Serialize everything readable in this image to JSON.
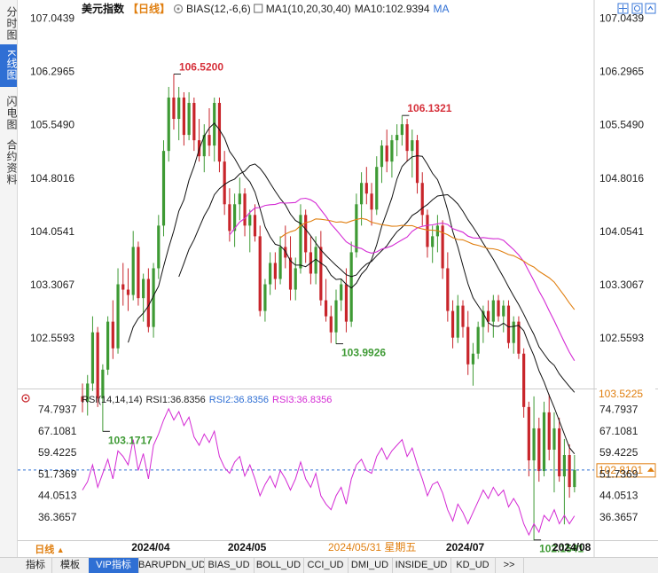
{
  "sidebar": {
    "tabs": [
      {
        "label": "分时图",
        "active": false
      },
      {
        "label": "K线图",
        "active": true
      },
      {
        "label": "闪电图",
        "active": false
      },
      {
        "label": "合约资料",
        "active": false
      }
    ]
  },
  "header": {
    "title": "美元指数",
    "period": "【日线】",
    "indicator": "BIAS(12,-6,6)",
    "ma_params": "MA1(10,20,30,40)",
    "ma10_value": "MA10:102.9394",
    "ma_tag": "MA"
  },
  "right_icons": {
    "analysis": "分析",
    "settings": "设置",
    "collapse": "收起"
  },
  "rsi_header": {
    "label": "RSI(14,14,14)",
    "rsi1": "RSI1:36.8356",
    "rsi2": "RSI2:36.8356",
    "rsi3": "RSI3:36.8356"
  },
  "bottom_bar": {
    "period_button": "日线",
    "tabs": [
      "指标",
      "模板",
      "VIP指标",
      "BARUPDN_UD",
      "BIAS_UD",
      "BOLL_UD",
      "CCI_UD",
      "DMI_UD",
      "INSIDE_UD",
      "KD_UD",
      ">>"
    ]
  },
  "colors": {
    "up": "#3e9a34",
    "down": "#c8252b",
    "ma10": "#111111",
    "ma20": "#111111",
    "ma30": "#d42ad4",
    "ma40": "#e07f10",
    "rsi": "#d42ad4",
    "current_price": "#2f6fd4",
    "date_highlight": "#e07f10"
  },
  "chart_data": [
    {
      "type": "candlestick",
      "title": "美元指数",
      "yticks": [
        "107.0439",
        "106.2965",
        "105.5490",
        "104.8016",
        "104.0541",
        "103.3067",
        "102.5593"
      ],
      "ylim": [
        102.2,
        107.04
      ],
      "xticks": [
        {
          "label": "2024/04",
          "index": 10
        },
        {
          "label": "2024/05",
          "index": 29
        },
        {
          "label": "2024/07",
          "index": 72
        },
        {
          "label": "2024/08",
          "index": 93
        }
      ],
      "crosshair_date": "2024/05/31 星期五",
      "current_price": "102.8101",
      "last_marker": "103.5225",
      "annotations": [
        {
          "label": "106.5200",
          "index": 18,
          "value": 106.52,
          "kind": "high"
        },
        {
          "label": "106.1321",
          "index": 63,
          "value": 106.1321,
          "kind": "high"
        },
        {
          "label": "103.9926",
          "index": 50,
          "value": 103.9926,
          "kind": "low"
        },
        {
          "label": "103.1717",
          "index": 4,
          "value": 103.1717,
          "kind": "low"
        },
        {
          "label": "102.1541",
          "index": 89,
          "value": 102.1541,
          "kind": "low"
        }
      ],
      "candles": [
        [
          103.5,
          103.62,
          103.35,
          103.45
        ],
        [
          103.45,
          103.7,
          103.32,
          103.62
        ],
        [
          103.62,
          104.25,
          103.55,
          104.1
        ],
        [
          104.1,
          104.15,
          103.4,
          103.48
        ],
        [
          103.48,
          103.8,
          103.17,
          103.75
        ],
        [
          103.75,
          104.25,
          103.7,
          104.2
        ],
        [
          104.2,
          104.4,
          103.85,
          103.95
        ],
        [
          103.95,
          104.7,
          103.9,
          104.55
        ],
        [
          104.55,
          104.75,
          104.35,
          104.5
        ],
        [
          104.5,
          104.7,
          104.3,
          104.45
        ],
        [
          104.45,
          105.05,
          104.4,
          104.9
        ],
        [
          104.9,
          104.95,
          104.35,
          104.42
        ],
        [
          104.42,
          104.65,
          104.2,
          104.6
        ],
        [
          104.6,
          104.7,
          104.1,
          104.15
        ],
        [
          104.15,
          104.75,
          104.05,
          104.7
        ],
        [
          104.7,
          105.2,
          104.6,
          105.1
        ],
        [
          105.1,
          105.9,
          105.0,
          105.8
        ],
        [
          105.8,
          106.4,
          105.7,
          106.3
        ],
        [
          106.3,
          106.52,
          106.0,
          106.1
        ],
        [
          106.1,
          106.4,
          105.9,
          106.3
        ],
        [
          106.3,
          106.35,
          105.85,
          105.95
        ],
        [
          105.95,
          106.35,
          105.9,
          106.25
        ],
        [
          106.25,
          106.3,
          105.8,
          105.9
        ],
        [
          105.9,
          106.1,
          105.7,
          105.75
        ],
        [
          105.75,
          106.05,
          105.6,
          105.95
        ],
        [
          105.95,
          106.2,
          105.75,
          105.85
        ],
        [
          105.85,
          106.3,
          105.7,
          106.25
        ],
        [
          106.25,
          106.3,
          105.6,
          105.7
        ],
        [
          105.7,
          105.8,
          105.2,
          105.3
        ],
        [
          105.3,
          105.45,
          104.95,
          105.05
        ],
        [
          105.05,
          105.4,
          104.9,
          105.3
        ],
        [
          105.3,
          105.55,
          105.15,
          105.4
        ],
        [
          105.4,
          105.45,
          105.0,
          105.1
        ],
        [
          105.1,
          105.25,
          104.85,
          105.2
        ],
        [
          105.2,
          105.3,
          104.95,
          105.0
        ],
        [
          105.0,
          105.1,
          104.25,
          104.3
        ],
        [
          104.3,
          104.6,
          104.2,
          104.55
        ],
        [
          104.55,
          104.85,
          104.45,
          104.75
        ],
        [
          104.75,
          104.85,
          104.5,
          104.6
        ],
        [
          104.6,
          105.0,
          104.55,
          104.9
        ],
        [
          104.9,
          105.1,
          104.7,
          104.8
        ],
        [
          104.8,
          105.0,
          104.4,
          104.5
        ],
        [
          104.5,
          104.8,
          104.4,
          104.7
        ],
        [
          104.7,
          105.3,
          104.65,
          105.2
        ],
        [
          105.2,
          105.25,
          104.75,
          104.85
        ],
        [
          104.85,
          105.0,
          104.55,
          104.65
        ],
        [
          104.65,
          105.0,
          104.55,
          104.9
        ],
        [
          104.9,
          105.05,
          104.35,
          104.4
        ],
        [
          104.4,
          104.6,
          104.2,
          104.25
        ],
        [
          104.25,
          104.35,
          104.0,
          104.1
        ],
        [
          104.1,
          104.5,
          103.99,
          104.4
        ],
        [
          104.4,
          104.6,
          104.3,
          104.55
        ],
        [
          104.55,
          104.7,
          104.1,
          104.2
        ],
        [
          104.2,
          104.95,
          104.15,
          104.85
        ],
        [
          104.85,
          105.4,
          104.8,
          105.3
        ],
        [
          105.3,
          105.6,
          105.1,
          105.5
        ],
        [
          105.5,
          105.65,
          105.3,
          105.4
        ],
        [
          105.4,
          105.5,
          105.1,
          105.25
        ],
        [
          105.25,
          105.75,
          105.2,
          105.65
        ],
        [
          105.65,
          105.9,
          105.5,
          105.85
        ],
        [
          105.85,
          106.0,
          105.6,
          105.7
        ],
        [
          105.7,
          105.95,
          105.55,
          105.9
        ],
        [
          105.9,
          106.05,
          105.75,
          105.95
        ],
        [
          105.95,
          106.13,
          105.85,
          106.05
        ],
        [
          106.05,
          106.1,
          105.7,
          105.8
        ],
        [
          105.8,
          106.0,
          105.55,
          105.9
        ],
        [
          105.9,
          105.95,
          105.4,
          105.5
        ],
        [
          105.5,
          105.6,
          105.1,
          105.2
        ],
        [
          105.2,
          105.25,
          104.8,
          104.9
        ],
        [
          104.9,
          105.1,
          104.75,
          105.0
        ],
        [
          105.0,
          105.2,
          104.85,
          105.1
        ],
        [
          105.1,
          105.15,
          104.6,
          104.7
        ],
        [
          104.7,
          104.85,
          104.2,
          104.3
        ],
        [
          104.3,
          104.4,
          103.95,
          104.05
        ],
        [
          104.05,
          104.45,
          104.0,
          104.35
        ],
        [
          104.35,
          104.4,
          104.05,
          104.15
        ],
        [
          104.15,
          104.3,
          103.7,
          103.8
        ],
        [
          103.8,
          104.0,
          103.6,
          103.9
        ],
        [
          103.9,
          104.2,
          103.85,
          104.15
        ],
        [
          104.15,
          104.35,
          104.0,
          104.3
        ],
        [
          104.3,
          104.4,
          104.1,
          104.2
        ],
        [
          104.2,
          104.45,
          104.05,
          104.4
        ],
        [
          104.4,
          104.45,
          104.2,
          104.25
        ],
        [
          104.25,
          104.4,
          104.1,
          104.35
        ],
        [
          104.35,
          104.4,
          103.95,
          104.0
        ],
        [
          104.0,
          104.25,
          103.9,
          104.2
        ],
        [
          104.2,
          104.25,
          103.85,
          103.9
        ],
        [
          103.9,
          103.95,
          103.3,
          103.4
        ],
        [
          103.4,
          103.45,
          102.75,
          102.9
        ],
        [
          102.9,
          103.5,
          102.15,
          103.2
        ],
        [
          103.2,
          103.3,
          102.7,
          102.8
        ],
        [
          102.8,
          103.45,
          102.75,
          103.35
        ],
        [
          103.35,
          103.52,
          102.9,
          103.0
        ],
        [
          103.0,
          103.35,
          102.6,
          103.2
        ],
        [
          103.2,
          103.3,
          102.7,
          102.75
        ],
        [
          102.75,
          103.1,
          102.3,
          102.95
        ],
        [
          102.95,
          103.05,
          102.55,
          102.65
        ],
        [
          102.65,
          102.95,
          102.6,
          102.81
        ]
      ]
    },
    {
      "type": "line",
      "title": "RSI(14,14,14)",
      "yticks": [
        "74.7937",
        "67.1081",
        "59.4225",
        "51.7369",
        "44.0513",
        "36.3657"
      ],
      "ylim": [
        32.0,
        77.0
      ],
      "series": [
        {
          "name": "RSI1",
          "values": [
            46,
            49,
            55,
            47,
            52,
            57,
            50,
            60,
            58,
            55,
            64,
            53,
            59,
            50,
            62,
            66,
            71,
            75,
            71,
            74,
            69,
            72,
            65,
            62,
            66,
            63,
            67,
            58,
            54,
            52,
            56,
            58,
            51,
            55,
            50,
            44,
            48,
            51,
            47,
            53,
            50,
            46,
            50,
            56,
            50,
            47,
            52,
            44,
            41,
            39,
            44,
            47,
            41,
            50,
            55,
            57,
            53,
            52,
            58,
            61,
            57,
            60,
            62,
            64,
            58,
            61,
            55,
            50,
            44,
            48,
            49,
            45,
            39,
            35,
            41,
            38,
            34,
            38,
            42,
            46,
            43,
            47,
            44,
            46,
            40,
            43,
            40,
            34,
            30,
            34,
            31,
            37,
            35,
            39,
            34,
            37,
            34,
            36.8
          ]
        }
      ]
    }
  ]
}
